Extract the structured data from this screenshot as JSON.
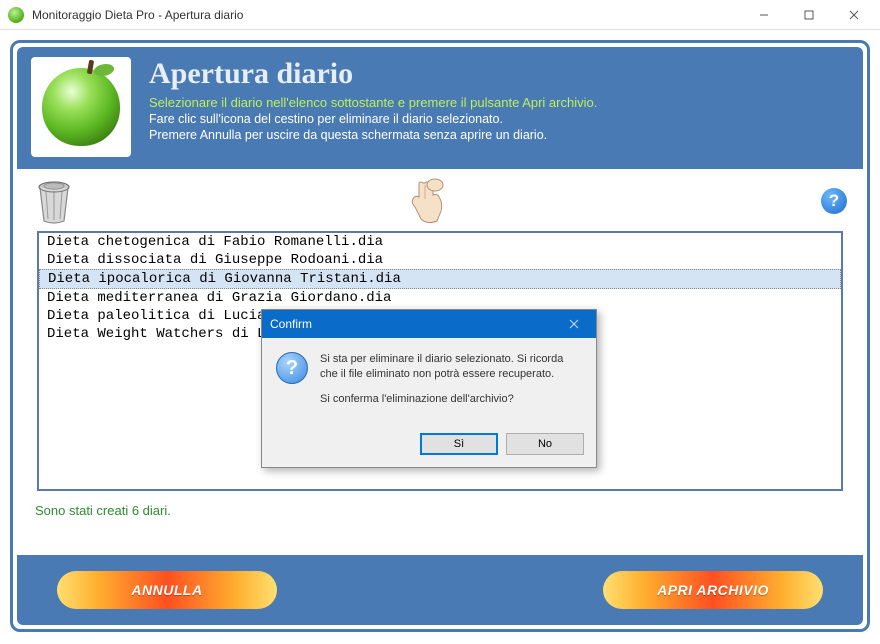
{
  "window": {
    "title": "Monitoraggio Dieta Pro - Apertura diario"
  },
  "header": {
    "title": "Apertura diario",
    "line1": "Selezionare il diario nell'elenco sottostante e premere il pulsante Apri archivio.",
    "line2": "Fare clic sull'icona del cestino per eliminare il diario selezionato.",
    "line3": "Premere Annulla per uscire da questa schermata senza aprire un diario."
  },
  "toolbar": {
    "help_glyph": "?"
  },
  "list": {
    "items": [
      "Dieta chetogenica di Fabio Romanelli.dia",
      "Dieta dissociata di Giuseppe Rodoani.dia",
      "Dieta ipocalorica di Giovanna Tristani.dia",
      "Dieta mediterranea di Grazia Giordano.dia",
      "Dieta paleolitica di Luciano Arnolfi.dia",
      "Dieta Weight Watchers di Lorenzo Vitale.dia"
    ],
    "selected_index": 2
  },
  "status": "Sono stati creati 6 diari.",
  "buttons": {
    "cancel": "ANNULLA",
    "open": "APRI ARCHIVIO"
  },
  "dialog": {
    "title": "Confirm",
    "icon_glyph": "?",
    "line1": "Si sta per eliminare il diario selezionato. Si ricorda che il file eliminato non potrà essere recuperato.",
    "line2": "Si conferma l'eliminazione dell'archivio?",
    "yes": "Sì",
    "no": "No"
  }
}
